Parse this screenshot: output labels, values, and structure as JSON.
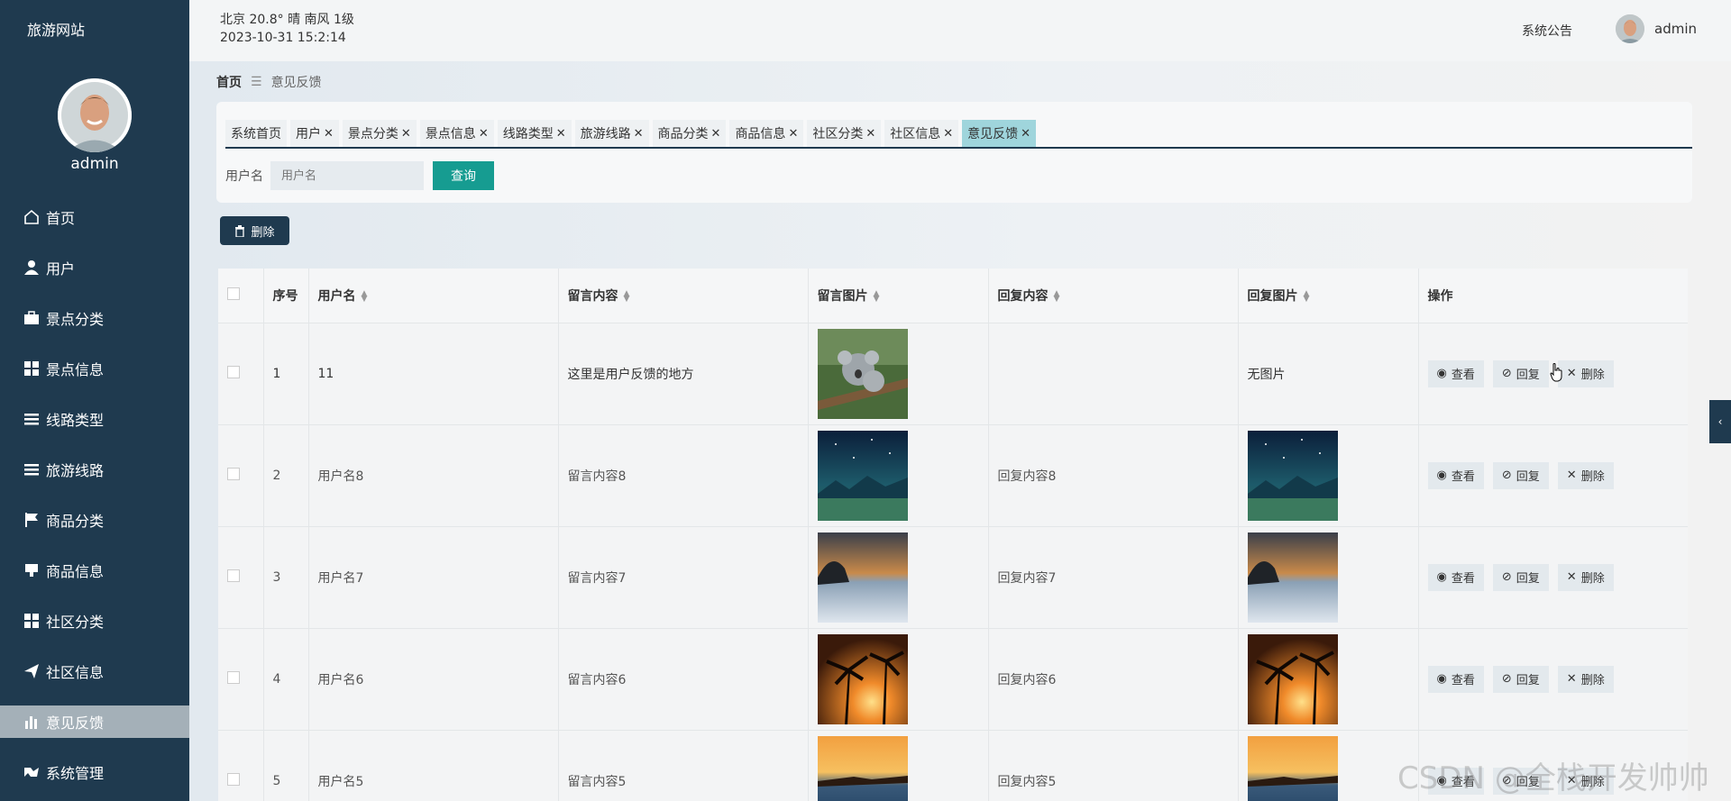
{
  "sidebar": {
    "site_title": "旅游网站",
    "admin_name": "admin",
    "items": [
      {
        "label": "首页",
        "icon": "home-icon"
      },
      {
        "label": "用户",
        "icon": "user-icon"
      },
      {
        "label": "景点分类",
        "icon": "briefcase-icon"
      },
      {
        "label": "景点信息",
        "icon": "grid-icon"
      },
      {
        "label": "线路类型",
        "icon": "list-icon"
      },
      {
        "label": "旅游线路",
        "icon": "list-icon"
      },
      {
        "label": "商品分类",
        "icon": "flag-icon"
      },
      {
        "label": "商品信息",
        "icon": "stamp-icon"
      },
      {
        "label": "社区分类",
        "icon": "grid-icon"
      },
      {
        "label": "社区信息",
        "icon": "send-icon"
      },
      {
        "label": "意见反馈",
        "icon": "bar-chart-icon",
        "active": true
      },
      {
        "label": "系统管理",
        "icon": "bird-icon"
      }
    ]
  },
  "header": {
    "weather": "北京  20.8°  晴  南风  1级",
    "datetime": "2023-10-31 15:2:14",
    "notice": "系统公告",
    "username": "admin"
  },
  "breadcrumb": {
    "home": "首页",
    "separator": "☰",
    "current": "意见反馈"
  },
  "tabs": [
    {
      "label": "系统首页",
      "closable": false
    },
    {
      "label": "用户",
      "closable": true
    },
    {
      "label": "景点分类",
      "closable": true
    },
    {
      "label": "景点信息",
      "closable": true
    },
    {
      "label": "线路类型",
      "closable": true
    },
    {
      "label": "旅游线路",
      "closable": true
    },
    {
      "label": "商品分类",
      "closable": true
    },
    {
      "label": "商品信息",
      "closable": true
    },
    {
      "label": "社区分类",
      "closable": true
    },
    {
      "label": "社区信息",
      "closable": true
    },
    {
      "label": "意见反馈",
      "closable": true,
      "active": true
    }
  ],
  "search": {
    "label": "用户名",
    "placeholder": "用户名",
    "button": "查询"
  },
  "toolbar": {
    "delete_label": "删除"
  },
  "table": {
    "columns": [
      "序号",
      "用户名",
      "留言内容",
      "留言图片",
      "回复内容",
      "回复图片",
      "操作"
    ],
    "ops": {
      "view": "查看",
      "reply": "回复",
      "delete": "删除"
    },
    "rows": [
      {
        "no": "1",
        "username": "11",
        "content": "这里是用户反馈的地方",
        "image": "koala",
        "reply": "",
        "reply_image": "",
        "reply_image_text": "无图片"
      },
      {
        "no": "2",
        "username": "用户名8",
        "content": "留言内容8",
        "image": "night-sky",
        "reply": "回复内容8",
        "reply_image": "night-sky",
        "reply_image_text": ""
      },
      {
        "no": "3",
        "username": "用户名7",
        "content": "留言内容7",
        "image": "dusk-lake",
        "reply": "回复内容7",
        "reply_image": "dusk-lake",
        "reply_image_text": ""
      },
      {
        "no": "4",
        "username": "用户名6",
        "content": "留言内容6",
        "image": "palm-sunset",
        "reply": "回复内容6",
        "reply_image": "palm-sunset",
        "reply_image_text": ""
      },
      {
        "no": "5",
        "username": "用户名5",
        "content": "留言内容5",
        "image": "sea-sunset",
        "reply": "回复内容5",
        "reply_image": "sea-sunset",
        "reply_image_text": ""
      }
    ]
  },
  "watermark": "CSDN @全栈开发帅帅"
}
